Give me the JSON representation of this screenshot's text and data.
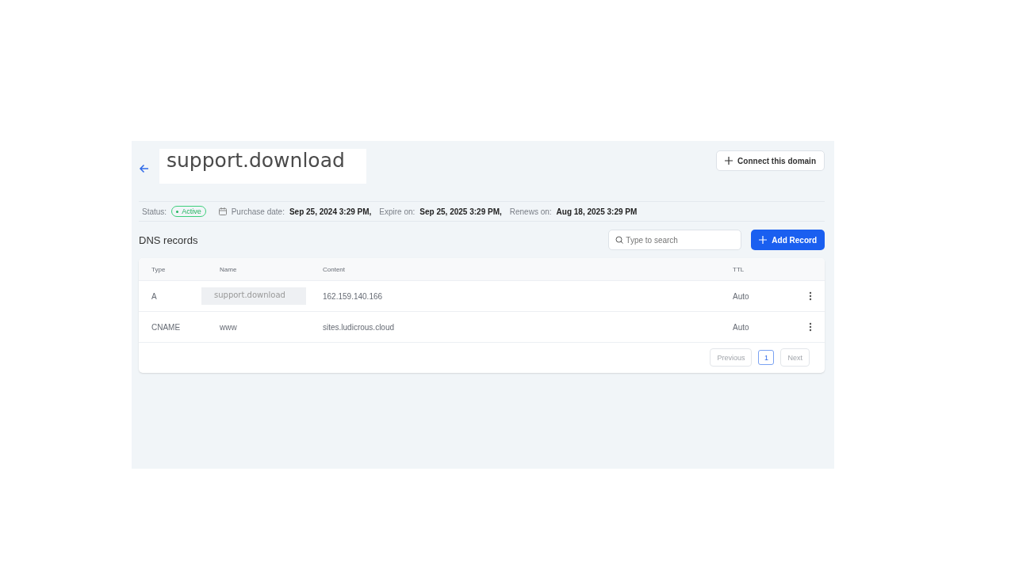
{
  "header": {
    "title": "support.download",
    "connect_button": "Connect this domain"
  },
  "status": {
    "label": "Status:",
    "badge": "Active",
    "active": true
  },
  "dates": [
    {
      "label": "Purchase date:",
      "value": "Sep 25, 2024 3:29 PM,"
    },
    {
      "label": "Expire on:",
      "value": "Sep 25, 2025 3:29 PM,"
    },
    {
      "label": "Renews on:",
      "value": "Aug 18, 2025 3:29 PM"
    }
  ],
  "dns": {
    "title": "DNS records",
    "search": {
      "placeholder": "Type to search"
    },
    "add_button": "Add Record"
  },
  "table": {
    "columns": [
      "Type",
      "Name",
      "Content",
      "TTL"
    ],
    "rows": [
      {
        "type": "A",
        "name": "support.download",
        "content": "162.159.140.166",
        "ttl": "Auto",
        "highlighted": true
      },
      {
        "type": "CNAME",
        "name": "www",
        "content": "sites.ludicrous.cloud",
        "ttl": "Auto",
        "highlighted": false
      }
    ]
  },
  "pagination": {
    "previous": {
      "label": "Previous",
      "disabled": true
    },
    "pages": [
      {
        "label": "1",
        "selected": true
      }
    ],
    "next": {
      "label": "Next",
      "disabled": true
    }
  }
}
